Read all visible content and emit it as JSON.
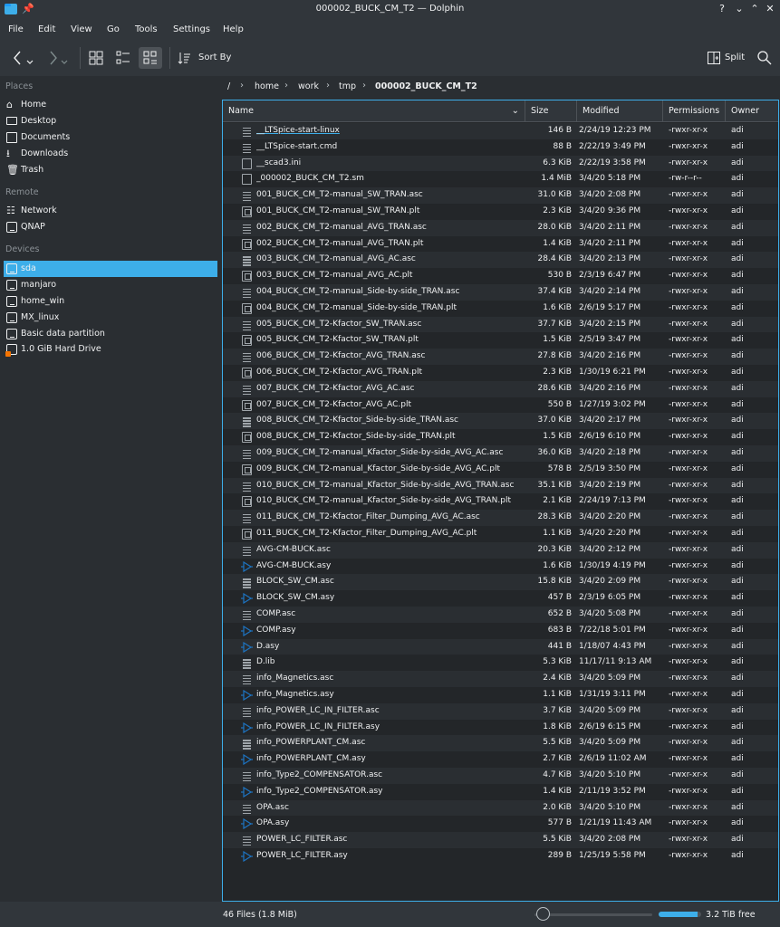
{
  "window": {
    "title": "000002_BUCK_CM_T2 — Dolphin",
    "pin_icon": "pin-icon",
    "controls": [
      "?",
      "⌄",
      "⌃",
      "✕"
    ]
  },
  "menu": [
    "File",
    "Edit",
    "View",
    "Go",
    "Tools",
    "Settings",
    "Help"
  ],
  "toolbar": {
    "sort_label": "Sort By",
    "split_label": "Split",
    "icons": [
      "back-icon",
      "forward-icon",
      "icons-view-icon",
      "compact-view-icon",
      "details-view-icon",
      "sort-icon",
      "split-icon",
      "search-icon"
    ]
  },
  "sidebar": {
    "sections": [
      {
        "title": "Places",
        "items": [
          {
            "label": "Home",
            "icon": "home-icon"
          },
          {
            "label": "Desktop",
            "icon": "desktop-icon"
          },
          {
            "label": "Documents",
            "icon": "documents-icon"
          },
          {
            "label": "Downloads",
            "icon": "downloads-icon"
          },
          {
            "label": "Trash",
            "icon": "trash-icon"
          }
        ]
      },
      {
        "title": "Remote",
        "items": [
          {
            "label": "Network",
            "icon": "network-icon"
          },
          {
            "label": "QNAP",
            "icon": "nas-icon"
          }
        ]
      },
      {
        "title": "Devices",
        "items": [
          {
            "label": "sda",
            "icon": "drive-icon",
            "selected": true
          },
          {
            "label": "manjaro",
            "icon": "drive-icon"
          },
          {
            "label": "home_win",
            "icon": "drive-icon"
          },
          {
            "label": "MX_linux",
            "icon": "drive-icon"
          },
          {
            "label": "Basic data partition",
            "icon": "drive-icon"
          },
          {
            "label": "1.0 GiB Hard Drive",
            "icon": "drive-warning-icon"
          }
        ]
      }
    ]
  },
  "breadcrumb": [
    "/",
    "home",
    "work",
    "tmp",
    "000002_BUCK_CM_T2"
  ],
  "columns": {
    "name": "Name",
    "size": "Size",
    "modified": "Modified",
    "permissions": "Permissions",
    "owner": "Owner"
  },
  "files": [
    {
      "name": "__LTSpice-start-linux",
      "size": "146 B",
      "modified": "2/24/19 12:23 PM",
      "perm": "-rwxr-xr-x",
      "owner": "adi",
      "icon": "text"
    },
    {
      "name": "__LTSpice-start.cmd",
      "size": "88 B",
      "modified": "2/22/19 3:49 PM",
      "perm": "-rwxr-xr-x",
      "owner": "adi",
      "icon": "text"
    },
    {
      "name": "__scad3.ini",
      "size": "6.3 KiB",
      "modified": "2/22/19 3:58 PM",
      "perm": "-rwxr-xr-x",
      "owner": "adi",
      "icon": "doc"
    },
    {
      "name": "_000002_BUCK_CM_T2.sm",
      "size": "1.4 MiB",
      "modified": "3/4/20 5:18 PM",
      "perm": "-rw-r--r--",
      "owner": "adi",
      "icon": "doc"
    },
    {
      "name": "001_BUCK_CM_T2-manual_SW_TRAN.asc",
      "size": "31.0 KiB",
      "modified": "3/4/20 2:08 PM",
      "perm": "-rwxr-xr-x",
      "owner": "adi",
      "icon": "text"
    },
    {
      "name": "001_BUCK_CM_T2-manual_SW_TRAN.plt",
      "size": "2.3 KiB",
      "modified": "3/4/20 9:36 PM",
      "perm": "-rwxr-xr-x",
      "owner": "adi",
      "icon": "plot"
    },
    {
      "name": "002_BUCK_CM_T2-manual_AVG_TRAN.asc",
      "size": "28.0 KiB",
      "modified": "3/4/20 2:11 PM",
      "perm": "-rwxr-xr-x",
      "owner": "adi",
      "icon": "text"
    },
    {
      "name": "002_BUCK_CM_T2-manual_AVG_TRAN.plt",
      "size": "1.4 KiB",
      "modified": "3/4/20 2:11 PM",
      "perm": "-rwxr-xr-x",
      "owner": "adi",
      "icon": "plot"
    },
    {
      "name": "003_BUCK_CM_T2-manual_AVG_AC.asc",
      "size": "28.4 KiB",
      "modified": "3/4/20 2:13 PM",
      "perm": "-rwxr-xr-x",
      "owner": "adi",
      "icon": "text"
    },
    {
      "name": "003_BUCK_CM_T2-manual_AVG_AC.plt",
      "size": "530 B",
      "modified": "2/3/19 6:47 PM",
      "perm": "-rwxr-xr-x",
      "owner": "adi",
      "icon": "plot"
    },
    {
      "name": "004_BUCK_CM_T2-manual_Side-by-side_TRAN.asc",
      "size": "37.4 KiB",
      "modified": "3/4/20 2:14 PM",
      "perm": "-rwxr-xr-x",
      "owner": "adi",
      "icon": "text"
    },
    {
      "name": "004_BUCK_CM_T2-manual_Side-by-side_TRAN.plt",
      "size": "1.6 KiB",
      "modified": "2/6/19 5:17 PM",
      "perm": "-rwxr-xr-x",
      "owner": "adi",
      "icon": "plot"
    },
    {
      "name": "005_BUCK_CM_T2-Kfactor_SW_TRAN.asc",
      "size": "37.7 KiB",
      "modified": "3/4/20 2:15 PM",
      "perm": "-rwxr-xr-x",
      "owner": "adi",
      "icon": "text"
    },
    {
      "name": "005_BUCK_CM_T2-Kfactor_SW_TRAN.plt",
      "size": "1.5 KiB",
      "modified": "2/5/19 3:47 PM",
      "perm": "-rwxr-xr-x",
      "owner": "adi",
      "icon": "plot"
    },
    {
      "name": "006_BUCK_CM_T2-Kfactor_AVG_TRAN.asc",
      "size": "27.8 KiB",
      "modified": "3/4/20 2:16 PM",
      "perm": "-rwxr-xr-x",
      "owner": "adi",
      "icon": "text"
    },
    {
      "name": "006_BUCK_CM_T2-Kfactor_AVG_TRAN.plt",
      "size": "2.3 KiB",
      "modified": "1/30/19 6:21 PM",
      "perm": "-rwxr-xr-x",
      "owner": "adi",
      "icon": "plot"
    },
    {
      "name": "007_BUCK_CM_T2-Kfactor_AVG_AC.asc",
      "size": "28.6 KiB",
      "modified": "3/4/20 2:16 PM",
      "perm": "-rwxr-xr-x",
      "owner": "adi",
      "icon": "text"
    },
    {
      "name": "007_BUCK_CM_T2-Kfactor_AVG_AC.plt",
      "size": "550 B",
      "modified": "1/27/19 3:02 PM",
      "perm": "-rwxr-xr-x",
      "owner": "adi",
      "icon": "plot"
    },
    {
      "name": "008_BUCK_CM_T2-Kfactor_Side-by-side_TRAN.asc",
      "size": "37.0 KiB",
      "modified": "3/4/20 2:17 PM",
      "perm": "-rwxr-xr-x",
      "owner": "adi",
      "icon": "text"
    },
    {
      "name": "008_BUCK_CM_T2-Kfactor_Side-by-side_TRAN.plt",
      "size": "1.5 KiB",
      "modified": "2/6/19 6:10 PM",
      "perm": "-rwxr-xr-x",
      "owner": "adi",
      "icon": "plot"
    },
    {
      "name": "009_BUCK_CM_T2-manual_Kfactor_Side-by-side_AVG_AC.asc",
      "size": "36.0 KiB",
      "modified": "3/4/20 2:18 PM",
      "perm": "-rwxr-xr-x",
      "owner": "adi",
      "icon": "text"
    },
    {
      "name": "009_BUCK_CM_T2-manual_Kfactor_Side-by-side_AVG_AC.plt",
      "size": "578 B",
      "modified": "2/5/19 3:50 PM",
      "perm": "-rwxr-xr-x",
      "owner": "adi",
      "icon": "plot"
    },
    {
      "name": "010_BUCK_CM_T2-manual_Kfactor_Side-by-side_AVG_TRAN.asc",
      "size": "35.1 KiB",
      "modified": "3/4/20 2:19 PM",
      "perm": "-rwxr-xr-x",
      "owner": "adi",
      "icon": "text"
    },
    {
      "name": "010_BUCK_CM_T2-manual_Kfactor_Side-by-side_AVG_TRAN.plt",
      "size": "2.1 KiB",
      "modified": "2/24/19 7:13 PM",
      "perm": "-rwxr-xr-x",
      "owner": "adi",
      "icon": "plot"
    },
    {
      "name": "011_BUCK_CM_T2-Kfactor_Filter_Dumping_AVG_AC.asc",
      "size": "28.3 KiB",
      "modified": "3/4/20 2:20 PM",
      "perm": "-rwxr-xr-x",
      "owner": "adi",
      "icon": "text"
    },
    {
      "name": "011_BUCK_CM_T2-Kfactor_Filter_Dumping_AVG_AC.plt",
      "size": "1.1 KiB",
      "modified": "3/4/20 2:20 PM",
      "perm": "-rwxr-xr-x",
      "owner": "adi",
      "icon": "plot"
    },
    {
      "name": "AVG-CM-BUCK.asc",
      "size": "20.3 KiB",
      "modified": "3/4/20 2:12 PM",
      "perm": "-rwxr-xr-x",
      "owner": "adi",
      "icon": "text"
    },
    {
      "name": "AVG-CM-BUCK.asy",
      "size": "1.6 KiB",
      "modified": "1/30/19 4:19 PM",
      "perm": "-rwxr-xr-x",
      "owner": "adi",
      "icon": "sym"
    },
    {
      "name": "BLOCK_SW_CM.asc",
      "size": "15.8 KiB",
      "modified": "3/4/20 2:09 PM",
      "perm": "-rwxr-xr-x",
      "owner": "adi",
      "icon": "text"
    },
    {
      "name": "BLOCK_SW_CM.asy",
      "size": "457 B",
      "modified": "2/3/19 6:05 PM",
      "perm": "-rwxr-xr-x",
      "owner": "adi",
      "icon": "sym"
    },
    {
      "name": "COMP.asc",
      "size": "652 B",
      "modified": "3/4/20 5:08 PM",
      "perm": "-rwxr-xr-x",
      "owner": "adi",
      "icon": "text"
    },
    {
      "name": "COMP.asy",
      "size": "683 B",
      "modified": "7/22/18 5:01 PM",
      "perm": "-rwxr-xr-x",
      "owner": "adi",
      "icon": "sym"
    },
    {
      "name": "D.asy",
      "size": "441 B",
      "modified": "1/18/07 4:43 PM",
      "perm": "-rwxr-xr-x",
      "owner": "adi",
      "icon": "sym"
    },
    {
      "name": "D.lib",
      "size": "5.3 KiB",
      "modified": "11/17/11 9:13 AM",
      "perm": "-rwxr-xr-x",
      "owner": "adi",
      "icon": "text"
    },
    {
      "name": "info_Magnetics.asc",
      "size": "2.4 KiB",
      "modified": "3/4/20 5:09 PM",
      "perm": "-rwxr-xr-x",
      "owner": "adi",
      "icon": "text"
    },
    {
      "name": "info_Magnetics.asy",
      "size": "1.1 KiB",
      "modified": "1/31/19 3:11 PM",
      "perm": "-rwxr-xr-x",
      "owner": "adi",
      "icon": "sym"
    },
    {
      "name": "info_POWER_LC_IN_FILTER.asc",
      "size": "3.7 KiB",
      "modified": "3/4/20 5:09 PM",
      "perm": "-rwxr-xr-x",
      "owner": "adi",
      "icon": "text"
    },
    {
      "name": "info_POWER_LC_IN_FILTER.asy",
      "size": "1.8 KiB",
      "modified": "2/6/19 6:15 PM",
      "perm": "-rwxr-xr-x",
      "owner": "adi",
      "icon": "sym"
    },
    {
      "name": "info_POWERPLANT_CM.asc",
      "size": "5.5 KiB",
      "modified": "3/4/20 5:09 PM",
      "perm": "-rwxr-xr-x",
      "owner": "adi",
      "icon": "text"
    },
    {
      "name": "info_POWERPLANT_CM.asy",
      "size": "2.7 KiB",
      "modified": "2/6/19 11:02 AM",
      "perm": "-rwxr-xr-x",
      "owner": "adi",
      "icon": "sym"
    },
    {
      "name": "info_Type2_COMPENSATOR.asc",
      "size": "4.7 KiB",
      "modified": "3/4/20 5:10 PM",
      "perm": "-rwxr-xr-x",
      "owner": "adi",
      "icon": "text"
    },
    {
      "name": "info_Type2_COMPENSATOR.asy",
      "size": "1.4 KiB",
      "modified": "2/11/19 3:52 PM",
      "perm": "-rwxr-xr-x",
      "owner": "adi",
      "icon": "sym"
    },
    {
      "name": "OPA.asc",
      "size": "2.0 KiB",
      "modified": "3/4/20 5:10 PM",
      "perm": "-rwxr-xr-x",
      "owner": "adi",
      "icon": "text"
    },
    {
      "name": "OPA.asy",
      "size": "577 B",
      "modified": "1/21/19 11:43 AM",
      "perm": "-rwxr-xr-x",
      "owner": "adi",
      "icon": "sym"
    },
    {
      "name": "POWER_LC_FILTER.asc",
      "size": "5.5 KiB",
      "modified": "3/4/20 2:08 PM",
      "perm": "-rwxr-xr-x",
      "owner": "adi",
      "icon": "text"
    },
    {
      "name": "POWER_LC_FILTER.asy",
      "size": "289 B",
      "modified": "1/25/19 5:58 PM",
      "perm": "-rwxr-xr-x",
      "owner": "adi",
      "icon": "sym"
    }
  ],
  "status": {
    "summary": "46 Files (1.8 MiB)",
    "free_space": "3.2 TiB free",
    "used_fraction": 0.92,
    "zoom_fraction": 0.0
  },
  "colors": {
    "accent": "#3daee9",
    "background": "#232629",
    "panel": "#31363b",
    "symbol": "#1d74c2"
  }
}
